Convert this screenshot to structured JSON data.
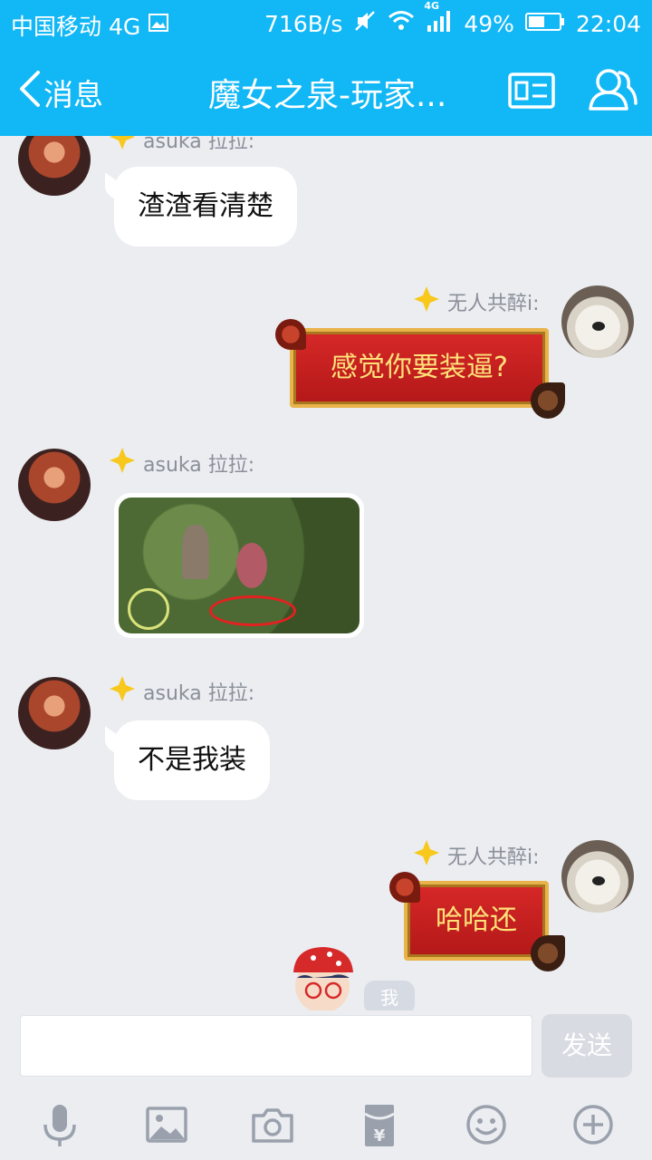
{
  "status_bar": {
    "carrier": "中国移动 4G",
    "speed": "716B/s",
    "signal_label": "4G",
    "battery": "49%",
    "time": "22:04"
  },
  "header": {
    "back_label": "消息",
    "title": "魔女之泉-玩家..."
  },
  "messages": [
    {
      "side": "left",
      "sender": "asuka 拉拉:",
      "type": "text",
      "text": "渣渣看清楚"
    },
    {
      "side": "right",
      "sender": "无人共醉i:",
      "type": "sticker",
      "text": "感觉你要装逼?"
    },
    {
      "side": "left",
      "sender": "asuka 拉拉:",
      "type": "image",
      "image_desc": "game screenshot"
    },
    {
      "side": "left",
      "sender": "asuka 拉拉:",
      "type": "text",
      "text": "不是我装"
    },
    {
      "side": "right",
      "sender": "无人共醉i:",
      "type": "sticker",
      "text": "哈哈还"
    }
  ],
  "me_badge": "我",
  "input": {
    "value": "",
    "placeholder": ""
  },
  "send_label": "发送",
  "toolbar": [
    "microphone-icon",
    "image-icon",
    "camera-icon",
    "red-envelope-icon",
    "emoji-icon",
    "plus-icon"
  ],
  "colors": {
    "accent": "#12b7f5",
    "background": "#ebedf1",
    "sticker_red": "#c81e1e",
    "sticker_gold": "#e8b34a"
  }
}
